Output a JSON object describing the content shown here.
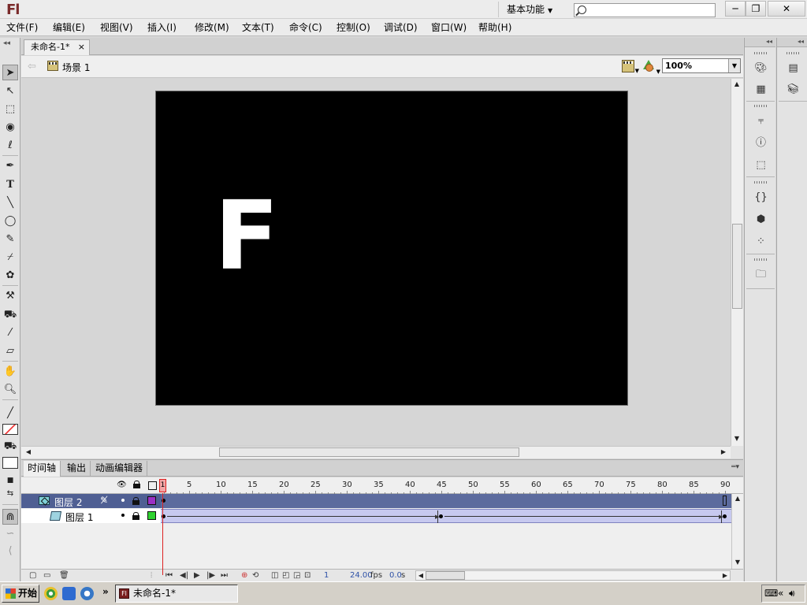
{
  "app": {
    "logo_text": "Fl",
    "workspace_label": "基本功能",
    "search": {
      "value": "",
      "placeholder": ""
    },
    "window_buttons": {
      "minimize": "─",
      "restore": "❐",
      "close": "✕"
    }
  },
  "menu": [
    {
      "label": "文件(F)"
    },
    {
      "label": "编辑(E)"
    },
    {
      "label": "视图(V)"
    },
    {
      "label": "插入(I)"
    },
    {
      "label": "修改(M)"
    },
    {
      "label": "文本(T)"
    },
    {
      "label": "命令(C)"
    },
    {
      "label": "控制(O)"
    },
    {
      "label": "调试(D)"
    },
    {
      "label": "窗口(W)"
    },
    {
      "label": "帮助(H)"
    }
  ],
  "document": {
    "tab_title": "未命名-1*",
    "tab_close": "×",
    "scene_label": "场景 1",
    "zoom": "100%",
    "stage_color": "#000000",
    "stage_text": "F",
    "stage_text_color": "#ffffff"
  },
  "panels": {
    "tabs": [
      "时间轴",
      "输出",
      "动画编辑器"
    ],
    "active_tab": "时间轴"
  },
  "timeline": {
    "frame_labels": [
      "1",
      "5",
      "10",
      "15",
      "20",
      "25",
      "30",
      "35",
      "40",
      "45",
      "50",
      "55",
      "60",
      "65",
      "70",
      "75",
      "80",
      "85",
      "90"
    ],
    "current_frame": "1",
    "layers": [
      {
        "name": "图层 2",
        "selected": true,
        "color": "#9b2fc4",
        "type": "folder",
        "keyframes": [
          1
        ]
      },
      {
        "name": "图层 1",
        "selected": false,
        "color": "#2fd12f",
        "type": "motion-tween",
        "keyframes": [
          1,
          45,
          90
        ],
        "tween_spans": [
          [
            1,
            45
          ],
          [
            45,
            90
          ]
        ]
      }
    ],
    "footer": {
      "frame": "1",
      "fps": "24.00",
      "fps_unit": "fps",
      "time": "0.0",
      "time_unit": "s"
    }
  },
  "taskbar": {
    "start_label": "开始",
    "window_label": "未命名-1*",
    "more": "»",
    "tray_collapse": "«"
  }
}
